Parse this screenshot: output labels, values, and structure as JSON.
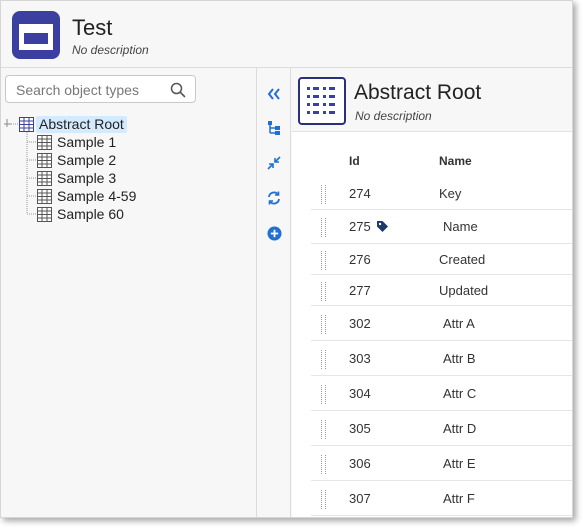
{
  "app": {
    "title": "Test",
    "subtitle": "No description"
  },
  "search": {
    "placeholder": "Search object types"
  },
  "tree": {
    "root": "Abstract Root",
    "children": [
      "Sample 1",
      "Sample 2",
      "Sample 3",
      "Sample 4-59",
      "Sample 60"
    ]
  },
  "toolbar": {
    "icons": [
      "collapse-panel-icon",
      "hierarchy-icon",
      "shrink-icon",
      "refresh-icon",
      "add-icon"
    ]
  },
  "detail": {
    "title": "Abstract Root",
    "subtitle": "No description"
  },
  "table": {
    "headers": {
      "id": "Id",
      "name": "Name"
    },
    "rows": [
      {
        "id": "274",
        "name": "Key",
        "tag": false
      },
      {
        "id": "275",
        "name": "Name",
        "tag": true
      },
      {
        "id": "276",
        "name": "Created",
        "tag": false
      },
      {
        "id": "277",
        "name": "Updated",
        "tag": false
      },
      {
        "id": "302",
        "name": "Attr A",
        "tag": false
      },
      {
        "id": "303",
        "name": "Attr B",
        "tag": false
      },
      {
        "id": "304",
        "name": "Attr C",
        "tag": false
      },
      {
        "id": "305",
        "name": "Attr D",
        "tag": false
      },
      {
        "id": "306",
        "name": "Attr E",
        "tag": false
      },
      {
        "id": "307",
        "name": "Attr F",
        "tag": false
      }
    ]
  },
  "colors": {
    "brand": "#3a3fa0",
    "accent": "#1f6fd6",
    "selection": "#d4ebff"
  }
}
